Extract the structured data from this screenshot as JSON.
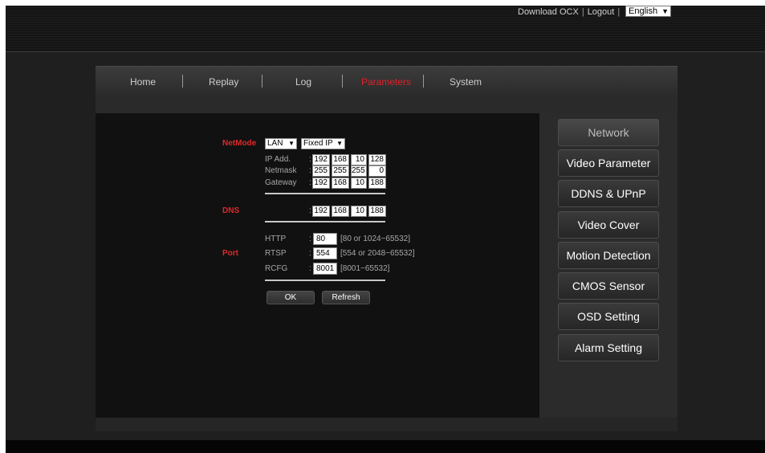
{
  "topbar": {
    "download_ocx": "Download OCX",
    "separator": "|",
    "logout": "Logout",
    "language": "English"
  },
  "nav": {
    "items": [
      {
        "label": "Home",
        "active": false
      },
      {
        "label": "Replay",
        "active": false
      },
      {
        "label": "Log",
        "active": false
      },
      {
        "label": "Parameters",
        "active": true
      },
      {
        "label": "System",
        "active": false
      }
    ]
  },
  "form": {
    "netmode_label": "NetMode",
    "netmode_value": "LAN",
    "ipmode_value": "Fixed IP",
    "ip_label": "IP Add.",
    "netmask_label": "Netmask",
    "gateway_label": "Gateway",
    "colon": ":",
    "ip": [
      "192",
      "168",
      "10",
      "128"
    ],
    "netmask": [
      "255",
      "255",
      "255",
      "0"
    ],
    "gateway": [
      "192",
      "168",
      "10",
      "188"
    ],
    "dns_label": "DNS",
    "dns": [
      "192",
      "168",
      "10",
      "188"
    ],
    "port_label": "Port",
    "http_label": "HTTP",
    "http_value": "80",
    "http_hint": "[80 or 1024~65532]",
    "rtsp_label": "RTSP",
    "rtsp_value": "554",
    "rtsp_hint": "[554 or 2048~65532]",
    "rcfg_label": "RCFG",
    "rcfg_value": "8001",
    "rcfg_hint": "[8001~65532]",
    "ok_label": "OK",
    "refresh_label": "Refresh"
  },
  "sidebar": {
    "items": [
      {
        "label": "Network",
        "active": true
      },
      {
        "label": "Video Parameter",
        "active": false
      },
      {
        "label": "DDNS & UPnP",
        "active": false
      },
      {
        "label": "Video Cover",
        "active": false
      },
      {
        "label": "Motion Detection",
        "active": false
      },
      {
        "label": "CMOS Sensor",
        "active": false
      },
      {
        "label": "OSD Setting",
        "active": false
      },
      {
        "label": "Alarm Setting",
        "active": false
      }
    ]
  },
  "colors": {
    "accent_red": "#e0202a",
    "label_red": "#dd2a2a"
  }
}
